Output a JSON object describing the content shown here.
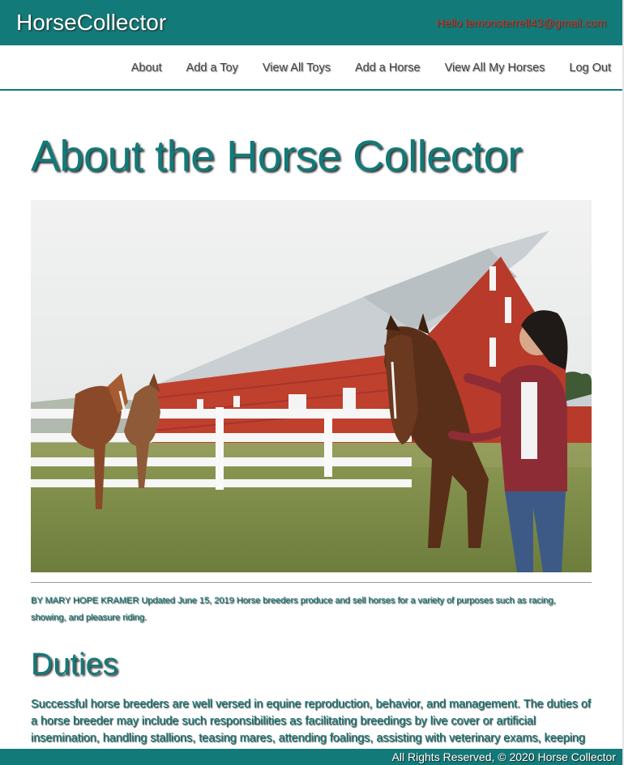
{
  "header": {
    "brand": "HorseCollector",
    "greeting": "Hello lemonsterrell43@gmail.com"
  },
  "nav": {
    "items": [
      {
        "label": "About"
      },
      {
        "label": "Add a Toy"
      },
      {
        "label": "View All Toys"
      },
      {
        "label": "Add a Horse"
      },
      {
        "label": "View All My Horses"
      },
      {
        "label": "Log Out"
      }
    ]
  },
  "main": {
    "title": "About the Horse Collector",
    "byline": "BY MARY HOPE KRAMER Updated June 15, 2019 Horse breeders produce and sell horses for a variety of purposes such as racing, showing, and pleasure riding.",
    "section_heading": "Duties",
    "body": "Successful horse breeders are well versed in equine reproduction, behavior, and management. The duties of a horse breeder may include such responsibilities as facilitating breedings by live cover or artificial insemination, handling stallions, teasing mares, attending foalings, assisting with veterinary exams, keeping"
  },
  "footer": {
    "text": "All Rights Reserved, © 2020 Horse Collector"
  },
  "colors": {
    "brand_teal": "#127a78",
    "greeting_red": "#c0392b"
  }
}
